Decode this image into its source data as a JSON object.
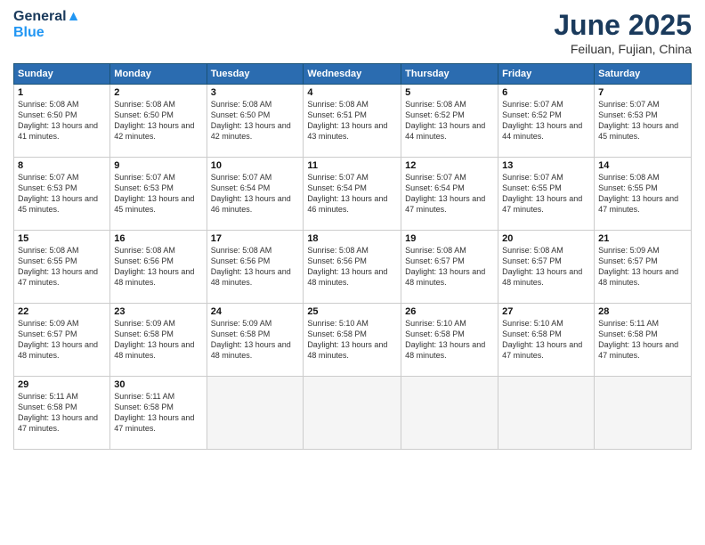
{
  "logo": {
    "line1": "General",
    "line2": "Blue"
  },
  "title": "June 2025",
  "location": "Feiluan, Fujian, China",
  "headers": [
    "Sunday",
    "Monday",
    "Tuesday",
    "Wednesday",
    "Thursday",
    "Friday",
    "Saturday"
  ],
  "weeks": [
    [
      {
        "day": "1",
        "rise": "5:08 AM",
        "set": "6:50 PM",
        "hours": "13 hours and 41 minutes."
      },
      {
        "day": "2",
        "rise": "5:08 AM",
        "set": "6:50 PM",
        "hours": "13 hours and 42 minutes."
      },
      {
        "day": "3",
        "rise": "5:08 AM",
        "set": "6:50 PM",
        "hours": "13 hours and 42 minutes."
      },
      {
        "day": "4",
        "rise": "5:08 AM",
        "set": "6:51 PM",
        "hours": "13 hours and 43 minutes."
      },
      {
        "day": "5",
        "rise": "5:08 AM",
        "set": "6:52 PM",
        "hours": "13 hours and 44 minutes."
      },
      {
        "day": "6",
        "rise": "5:07 AM",
        "set": "6:52 PM",
        "hours": "13 hours and 44 minutes."
      },
      {
        "day": "7",
        "rise": "5:07 AM",
        "set": "6:53 PM",
        "hours": "13 hours and 45 minutes."
      }
    ],
    [
      {
        "day": "8",
        "rise": "5:07 AM",
        "set": "6:53 PM",
        "hours": "13 hours and 45 minutes."
      },
      {
        "day": "9",
        "rise": "5:07 AM",
        "set": "6:53 PM",
        "hours": "13 hours and 45 minutes."
      },
      {
        "day": "10",
        "rise": "5:07 AM",
        "set": "6:54 PM",
        "hours": "13 hours and 46 minutes."
      },
      {
        "day": "11",
        "rise": "5:07 AM",
        "set": "6:54 PM",
        "hours": "13 hours and 46 minutes."
      },
      {
        "day": "12",
        "rise": "5:07 AM",
        "set": "6:54 PM",
        "hours": "13 hours and 47 minutes."
      },
      {
        "day": "13",
        "rise": "5:07 AM",
        "set": "6:55 PM",
        "hours": "13 hours and 47 minutes."
      },
      {
        "day": "14",
        "rise": "5:08 AM",
        "set": "6:55 PM",
        "hours": "13 hours and 47 minutes."
      }
    ],
    [
      {
        "day": "15",
        "rise": "5:08 AM",
        "set": "6:55 PM",
        "hours": "13 hours and 47 minutes."
      },
      {
        "day": "16",
        "rise": "5:08 AM",
        "set": "6:56 PM",
        "hours": "13 hours and 48 minutes."
      },
      {
        "day": "17",
        "rise": "5:08 AM",
        "set": "6:56 PM",
        "hours": "13 hours and 48 minutes."
      },
      {
        "day": "18",
        "rise": "5:08 AM",
        "set": "6:56 PM",
        "hours": "13 hours and 48 minutes."
      },
      {
        "day": "19",
        "rise": "5:08 AM",
        "set": "6:57 PM",
        "hours": "13 hours and 48 minutes."
      },
      {
        "day": "20",
        "rise": "5:08 AM",
        "set": "6:57 PM",
        "hours": "13 hours and 48 minutes."
      },
      {
        "day": "21",
        "rise": "5:09 AM",
        "set": "6:57 PM",
        "hours": "13 hours and 48 minutes."
      }
    ],
    [
      {
        "day": "22",
        "rise": "5:09 AM",
        "set": "6:57 PM",
        "hours": "13 hours and 48 minutes."
      },
      {
        "day": "23",
        "rise": "5:09 AM",
        "set": "6:58 PM",
        "hours": "13 hours and 48 minutes."
      },
      {
        "day": "24",
        "rise": "5:09 AM",
        "set": "6:58 PM",
        "hours": "13 hours and 48 minutes."
      },
      {
        "day": "25",
        "rise": "5:10 AM",
        "set": "6:58 PM",
        "hours": "13 hours and 48 minutes."
      },
      {
        "day": "26",
        "rise": "5:10 AM",
        "set": "6:58 PM",
        "hours": "13 hours and 48 minutes."
      },
      {
        "day": "27",
        "rise": "5:10 AM",
        "set": "6:58 PM",
        "hours": "13 hours and 47 minutes."
      },
      {
        "day": "28",
        "rise": "5:11 AM",
        "set": "6:58 PM",
        "hours": "13 hours and 47 minutes."
      }
    ],
    [
      {
        "day": "29",
        "rise": "5:11 AM",
        "set": "6:58 PM",
        "hours": "13 hours and 47 minutes."
      },
      {
        "day": "30",
        "rise": "5:11 AM",
        "set": "6:58 PM",
        "hours": "13 hours and 47 minutes."
      },
      null,
      null,
      null,
      null,
      null
    ]
  ]
}
